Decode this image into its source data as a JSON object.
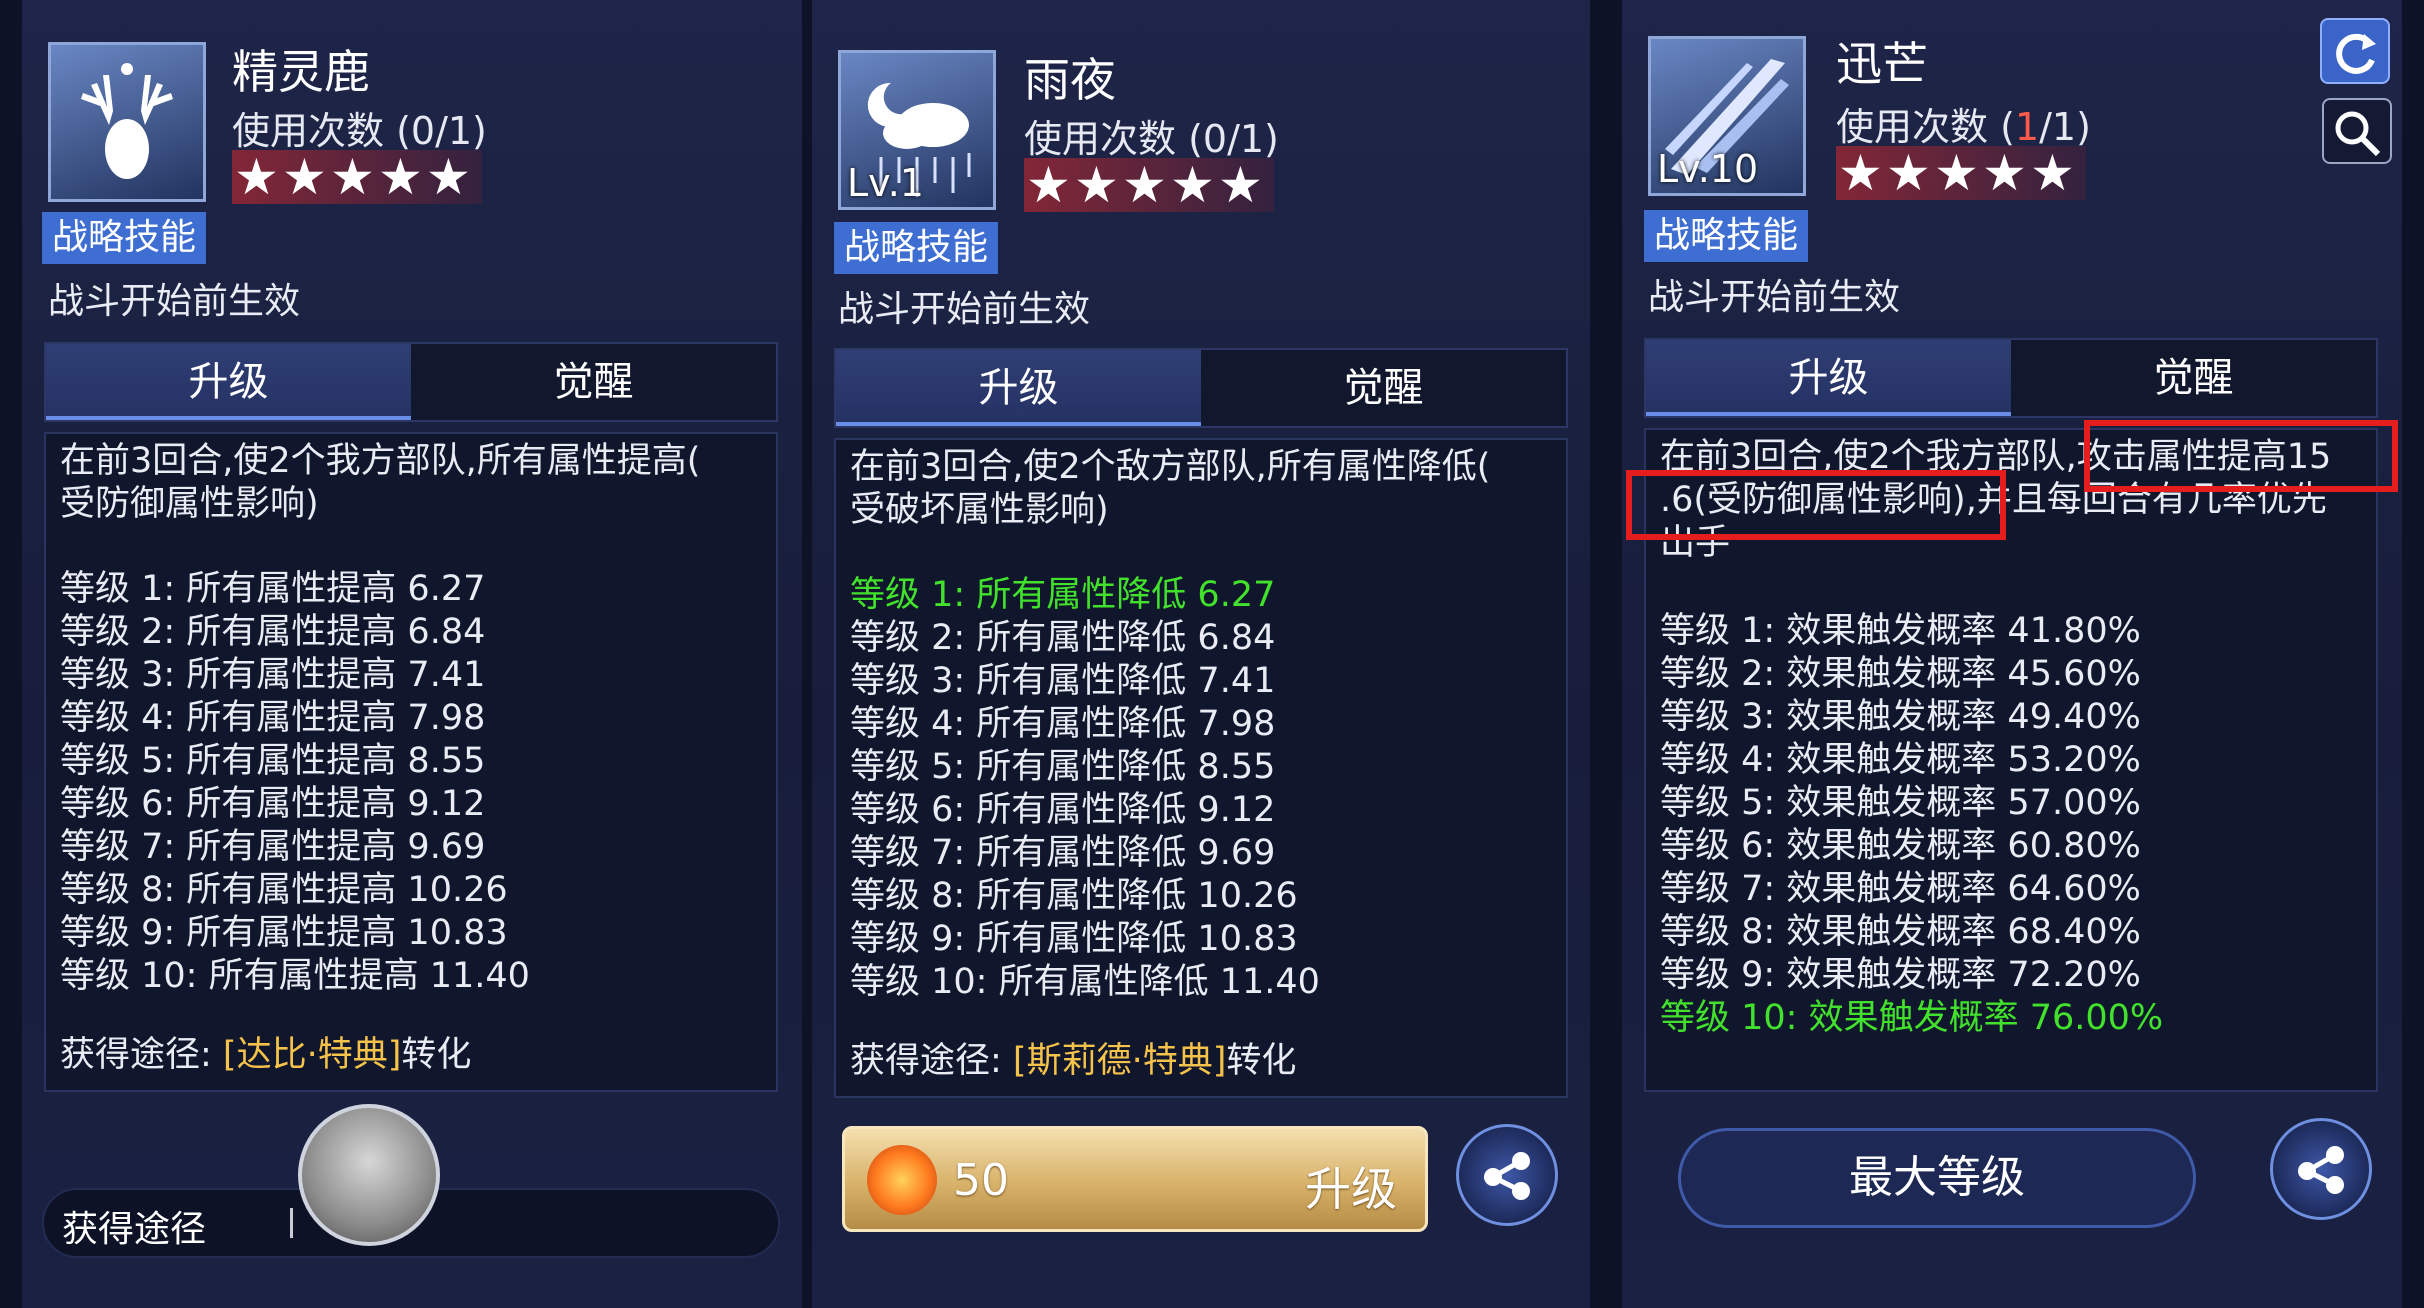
{
  "colors": {
    "accent_blue": "#3e6ed2",
    "highlight_green": "#42e22c",
    "source_gold": "#f5c24a",
    "uses_red": "#ff5a4a",
    "annotation_red": "#e51d1d"
  },
  "panels": [
    {
      "name": "精灵鹿",
      "uses_label": "使用次数 (0/1)",
      "star_rating": 5,
      "tag": "战略技能",
      "effect": "战斗开始前生效",
      "tabs": [
        "升级",
        "觉醒"
      ],
      "description_lines": [
        "在前3回合,使2个我方部队,所有属性提高(",
        "受防御属性影响)"
      ],
      "levels": [
        "等级 1:  所有属性提高 6.27",
        "等级 2:  所有属性提高 6.84",
        "等级 3:  所有属性提高 7.41",
        "等级 4:  所有属性提高 7.98",
        "等级 5:  所有属性提高 8.55",
        "等级 6:  所有属性提高 9.12",
        "等级 7:  所有属性提高 9.69",
        "等级 8:  所有属性提高 10.26",
        "等级 9:  所有属性提高 10.83",
        "等级 10:  所有属性提高 11.40"
      ],
      "source_prefix": "获得途径: ",
      "source_name": "[达比·特典]",
      "source_suffix": "转化",
      "obtain_label": "获得途径",
      "icon": "deer-icon"
    },
    {
      "name": "雨夜",
      "level_badge": "Lv.1",
      "uses_label": "使用次数 (0/1)",
      "star_rating": 5,
      "tag": "战略技能",
      "effect": "战斗开始前生效",
      "tabs": [
        "升级",
        "觉醒"
      ],
      "description_lines": [
        "在前3回合,使2个敌方部队,所有属性降低(",
        "受破坏属性影响)"
      ],
      "levels": [
        "等级 1:  所有属性降低 6.27",
        "等级 2:  所有属性降低 6.84",
        "等级 3:  所有属性降低 7.41",
        "等级 4:  所有属性降低 7.98",
        "等级 5:  所有属性降低 8.55",
        "等级 6:  所有属性降低 9.12",
        "等级 7:  所有属性降低 9.69",
        "等级 8:  所有属性降低 10.26",
        "等级 9:  所有属性降低 10.83",
        "等级 10:  所有属性降低 11.40"
      ],
      "current_level_index": 0,
      "source_prefix": "获得途径: ",
      "source_name": "[斯莉德·特典]",
      "source_suffix": "转化",
      "upgrade_cost": "50",
      "upgrade_label": "升级",
      "icon": "rain-moon-icon"
    },
    {
      "name": "迅芒",
      "level_badge": "Lv.10",
      "uses_prefix": "使用次数 (",
      "uses_current": "1",
      "uses_suffix": "/1)",
      "star_rating": 5,
      "tag": "战略技能",
      "effect": "战斗开始前生效",
      "tabs": [
        "升级",
        "觉醒"
      ],
      "description_lines": [
        "在前3回合,使2个我方部队,攻击属性提高15",
        ".6(受防御属性影响),并且每回合有几率优先",
        "出手"
      ],
      "levels": [
        "等级 1:  效果触发概率 41.80%",
        "等级 2:  效果触发概率 45.60%",
        "等级 3:  效果触发概率 49.40%",
        "等级 4:  效果触发概率 53.20%",
        "等级 5:  效果触发概率 57.00%",
        "等级 6:  效果触发概率 60.80%",
        "等级 7:  效果触发概率 64.60%",
        "等级 8:  效果触发概率 68.40%",
        "等级 9:  效果触发概率 72.20%",
        "等级 10:  效果触发概率 76.00%"
      ],
      "current_level_index": 9,
      "max_level_label": "最大等级",
      "icon": "lightning-streak-icon"
    }
  ]
}
